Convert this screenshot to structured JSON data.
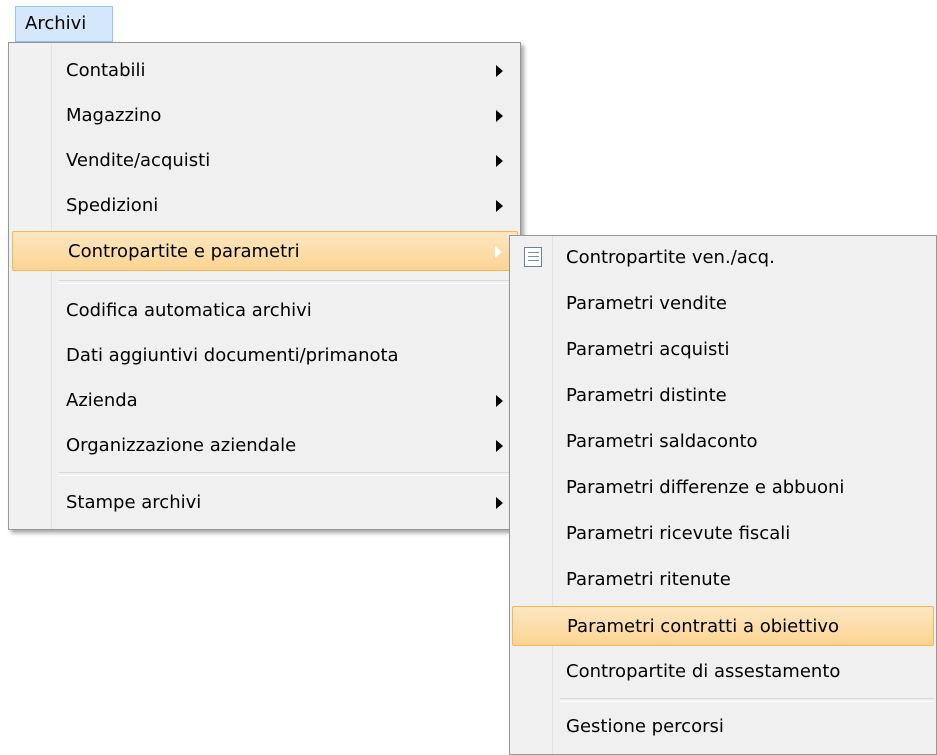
{
  "menubar": {
    "archivi_label": "Archivi"
  },
  "main_menu": {
    "items": [
      {
        "label": "Contabili",
        "submenu": true
      },
      {
        "label": "Magazzino",
        "submenu": true
      },
      {
        "label": "Vendite/acquisti",
        "submenu": true
      },
      {
        "label": "Spedizioni",
        "submenu": true
      },
      {
        "label": "Contropartite e parametri",
        "submenu": true,
        "highlighted": true
      },
      {
        "label": "Codifica automatica archivi",
        "submenu": false
      },
      {
        "label": "Dati aggiuntivi documenti/primanota",
        "submenu": false
      },
      {
        "label": "Azienda",
        "submenu": true
      },
      {
        "label": "Organizzazione aziendale",
        "submenu": true
      },
      {
        "label": "Stampe archivi",
        "submenu": true
      }
    ]
  },
  "sub_menu": {
    "items": [
      {
        "label": "Contropartite ven./acq.",
        "icon": "list-icon"
      },
      {
        "label": "Parametri vendite"
      },
      {
        "label": "Parametri acquisti"
      },
      {
        "label": "Parametri distinte"
      },
      {
        "label": "Parametri saldaconto"
      },
      {
        "label": "Parametri differenze e abbuoni"
      },
      {
        "label": "Parametri ricevute fiscali"
      },
      {
        "label": "Parametri ritenute"
      },
      {
        "label": "Parametri contratti a obiettivo",
        "highlighted": true
      },
      {
        "label": "Contropartite di assestamento"
      },
      {
        "label": "Gestione percorsi"
      }
    ]
  },
  "colors": {
    "highlight_fill": "#fbd492",
    "highlight_border": "#f3b755",
    "menu_background": "#f0f0f0",
    "menubar_active": "#d5e8fb"
  }
}
